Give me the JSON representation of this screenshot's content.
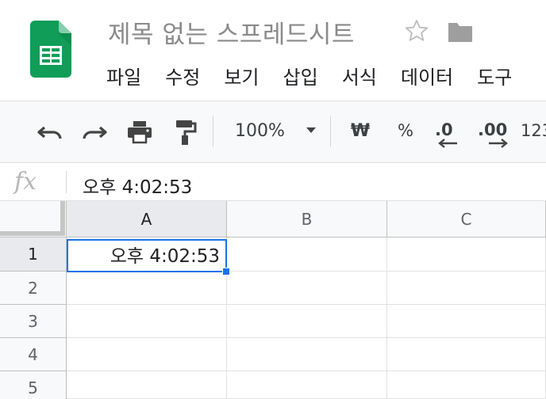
{
  "doc": {
    "title": "제목 없는 스프레드시트"
  },
  "menu": {
    "items": [
      {
        "label": "파일"
      },
      {
        "label": "수정"
      },
      {
        "label": "보기"
      },
      {
        "label": "삽입"
      },
      {
        "label": "서식"
      },
      {
        "label": "데이터"
      },
      {
        "label": "도구"
      }
    ]
  },
  "toolbar": {
    "zoom": "100%",
    "currency": "₩",
    "percent": "%",
    "decrease_decimal": ".0",
    "increase_decimal": ".00",
    "more_formats": "123"
  },
  "formula_bar": {
    "fx_label": "fx",
    "value": "오후 4:02:53"
  },
  "grid": {
    "columns": [
      "A",
      "B",
      "C"
    ],
    "rows": [
      "1",
      "2",
      "3",
      "4",
      "5"
    ],
    "cells": {
      "A1": "오후 4:02:53"
    },
    "selected_cell": "A1"
  },
  "colors": {
    "selection": "#1a73e8",
    "sheets_green": "#0f9d58"
  },
  "icons": {
    "logo": "google-sheets-logo",
    "star": "star-outline-icon",
    "folder": "folder-icon",
    "undo": "undo-icon",
    "redo": "redo-icon",
    "print": "print-icon",
    "paint_format": "paint-format-icon",
    "dropdown": "caret-down-icon"
  }
}
